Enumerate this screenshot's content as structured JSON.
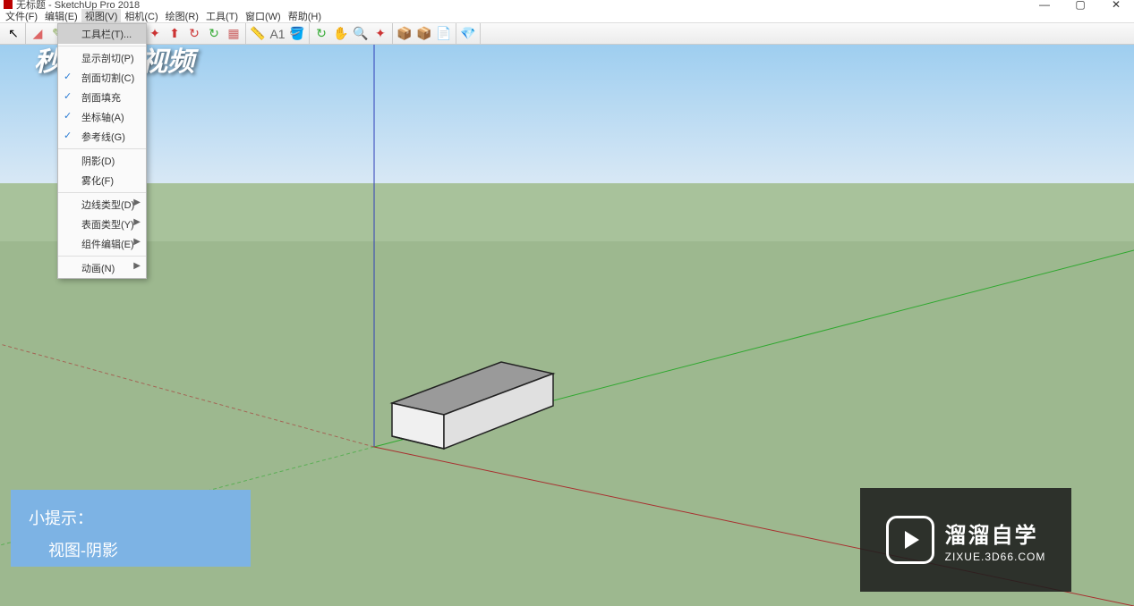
{
  "titlebar": {
    "title": "无标题 - SketchUp Pro 2018"
  },
  "menubar": {
    "items": [
      "文件(F)",
      "编辑(E)",
      "视图(V)",
      "相机(C)",
      "绘图(R)",
      "工具(T)",
      "窗口(W)",
      "帮助(H)"
    ]
  },
  "dropdown": {
    "groups": [
      [
        {
          "label": "工具栏(T)...",
          "checked": false,
          "submenu": false,
          "highlight": true
        }
      ],
      [
        {
          "label": "显示剖切(P)",
          "checked": false,
          "submenu": false
        },
        {
          "label": "剖面切割(C)",
          "checked": true,
          "submenu": false
        },
        {
          "label": "剖面填充",
          "checked": true,
          "submenu": false
        },
        {
          "label": "坐标轴(A)",
          "checked": true,
          "submenu": false
        },
        {
          "label": "参考线(G)",
          "checked": true,
          "submenu": false
        }
      ],
      [
        {
          "label": "阴影(D)",
          "checked": false,
          "submenu": false
        },
        {
          "label": "雾化(F)",
          "checked": false,
          "submenu": false
        }
      ],
      [
        {
          "label": "边线类型(D)",
          "checked": false,
          "submenu": true
        },
        {
          "label": "表面类型(Y)",
          "checked": false,
          "submenu": true
        },
        {
          "label": "组件编辑(E)",
          "checked": false,
          "submenu": true
        }
      ],
      [
        {
          "label": "动画(N)",
          "checked": false,
          "submenu": true
        }
      ]
    ]
  },
  "tip": {
    "title": "小提示：",
    "content": "视图-阴影"
  },
  "brand": {
    "main": "溜溜自学",
    "sub": "ZIXUE.3D66.COM"
  },
  "watermark": {
    "text1": "秒",
    "text2": "ong视频"
  },
  "colors": {
    "sky": "#b9d9ef",
    "ground": "#9db88f",
    "axis_blue": "#2f3fb8",
    "axis_green": "#2fa82f",
    "axis_red": "#a82f2f"
  }
}
